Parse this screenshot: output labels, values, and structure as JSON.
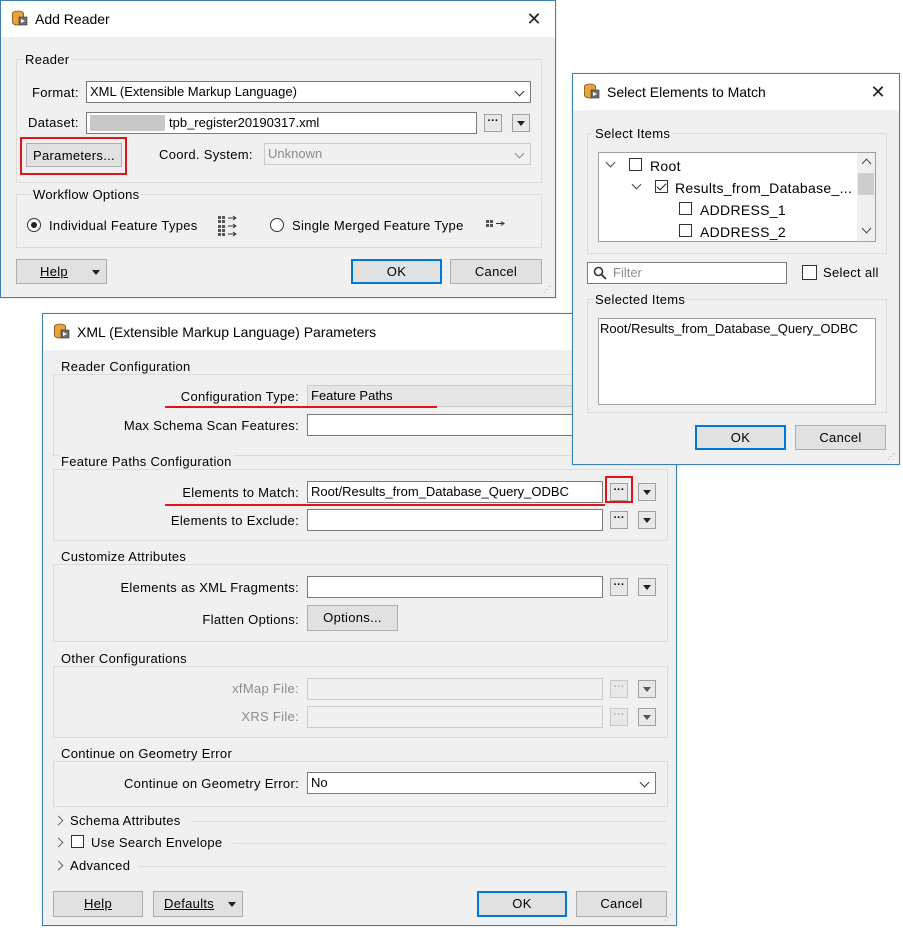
{
  "add_reader": {
    "title": "Add Reader",
    "close": "✕",
    "reader_group": "Reader",
    "format_label": "Format:",
    "format_value": "XML (Extensible Markup Language)",
    "dataset_label": "Dataset:",
    "dataset_value": "tpb_register20190317.xml",
    "parameters_button": "Parameters...",
    "coord_label": "Coord. System:",
    "coord_value": "Unknown",
    "workflow_group": "Workflow Options",
    "option_individual": "Individual Feature Types",
    "option_single": "Single Merged Feature Type",
    "help": "Help",
    "ok": "OK",
    "cancel": "Cancel",
    "ellipsis": "···"
  },
  "select_elements": {
    "title": "Select Elements to Match",
    "close": "✕",
    "select_items_group": "Select Items",
    "tree": [
      {
        "label": "Root"
      },
      {
        "label": "Results_from_Database_..."
      },
      {
        "label": "ADDRESS_1"
      },
      {
        "label": "ADDRESS_2"
      }
    ],
    "filter_placeholder": "Filter",
    "select_all": "Select all",
    "selected_group": "Selected Items",
    "selected_value": "Root/Results_from_Database_Query_ODBC",
    "ok": "OK",
    "cancel": "Cancel"
  },
  "params": {
    "title": "XML (Extensible Markup Language) Parameters",
    "reader_config_group": "Reader Configuration",
    "config_type_label": "Configuration Type:",
    "config_type_value": "Feature Paths",
    "max_scan_label": "Max Schema Scan Features:",
    "max_scan_value": "",
    "feature_paths_group": "Feature Paths Configuration",
    "elements_match_label": "Elements to Match:",
    "elements_match_value": "Root/Results_from_Database_Query_ODBC",
    "elements_exclude_label": "Elements to Exclude:",
    "elements_exclude_value": "",
    "customize_group": "Customize Attributes",
    "fragments_label": "Elements as XML Fragments:",
    "fragments_value": "",
    "flatten_label": "Flatten Options:",
    "options_button": "Options...",
    "other_group": "Other Configurations",
    "xfmap_label": "xfMap File:",
    "xrs_label": "XRS File:",
    "geom_group": "Continue on Geometry Error",
    "geom_label": "Continue on Geometry Error:",
    "geom_value": "No",
    "schema_attributes": "Schema Attributes",
    "use_search_envelope": "Use Search Envelope",
    "advanced": "Advanced",
    "help": "Help",
    "defaults": "Defaults",
    "ok": "OK",
    "cancel": "Cancel",
    "ellipsis": "···"
  }
}
